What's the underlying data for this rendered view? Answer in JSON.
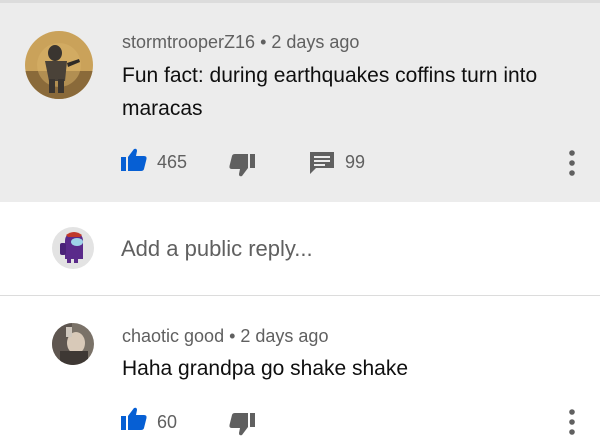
{
  "comment": {
    "author": "stormtrooperZ16",
    "time": "2 days ago",
    "text": "Fun fact: during earthquakes coffins turn into maracas",
    "likes": "465",
    "replies": "99"
  },
  "reply_box": {
    "placeholder": "Add a public reply..."
  },
  "reply": {
    "author": "chaotic good",
    "time": "2 days ago",
    "text": "Haha grandpa go shake shake",
    "likes": "60"
  },
  "colors": {
    "like_blue": "#065fd4",
    "icon_grey": "#606060",
    "highlight_bg": "#ececec"
  },
  "icons": {
    "like": "thumbs-up-icon",
    "dislike": "thumbs-down-icon",
    "replies": "comment-icon",
    "menu": "more-vertical-icon"
  }
}
